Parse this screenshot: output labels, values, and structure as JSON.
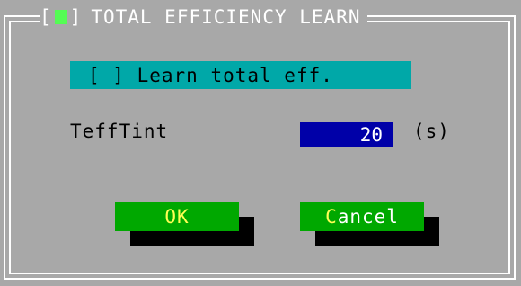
{
  "dialog": {
    "title": "TOTAL EFFICIENCY LEARN",
    "close_box_left": "[",
    "close_box_right": "]"
  },
  "options": {
    "learn_total_eff": {
      "box": "[ ]",
      "label": "Learn total eff.",
      "checked": false
    }
  },
  "fields": {
    "teff_tint": {
      "label": "TeffTint",
      "value": "20",
      "unit": "(s)"
    }
  },
  "buttons": {
    "ok": {
      "hotkey": "OK",
      "rest": ""
    },
    "cancel": {
      "hotkey": "C",
      "rest": "ancel"
    }
  },
  "colors": {
    "background": "#a8a8a8",
    "frame": "#ffffff",
    "checkbox_row": "#00a8a8",
    "input_bg": "#0000a8",
    "button_bg": "#00a800",
    "hotkey": "#ffff54",
    "close_square": "#54fc54"
  }
}
